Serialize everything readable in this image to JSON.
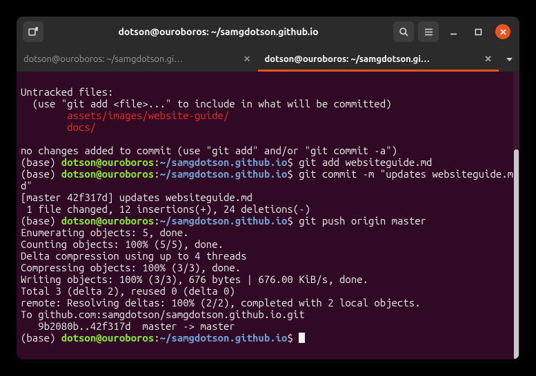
{
  "titlebar": {
    "title": "dotson@ouroboros: ~/samgdotson.github.io"
  },
  "tabs": [
    {
      "label": "dotson@ouroboros: ~/samgdotson.gi…",
      "active": false
    },
    {
      "label": "dotson@ouroboros: ~/samgdotson.gi…",
      "active": true
    }
  ],
  "scrollbar": {
    "top_pct": 27,
    "height_pct": 73
  },
  "prompt": {
    "base": "(base) ",
    "user_host": "dotson@ouroboros",
    "colon": ":",
    "cwd": "~/samgdotson.github.io",
    "dollar": "$ "
  },
  "lines": [
    {
      "t": "plain",
      "text": ""
    },
    {
      "t": "plain",
      "text": "Untracked files:"
    },
    {
      "t": "plain",
      "text": "  (use \"git add <file>...\" to include in what will be committed)"
    },
    {
      "t": "red",
      "text": "        assets/images/website-guide/"
    },
    {
      "t": "red",
      "text": "        docs/"
    },
    {
      "t": "plain",
      "text": ""
    },
    {
      "t": "plain",
      "text": "no changes added to commit (use \"git add\" and/or \"git commit -a\")"
    },
    {
      "t": "prompt",
      "cmd": "git add websiteguide.md"
    },
    {
      "t": "prompt",
      "cmd": "git commit -m \"updates websiteguide.md\""
    },
    {
      "t": "plain",
      "text": "[master 42f317d] updates websiteguide.md"
    },
    {
      "t": "plain",
      "text": " 1 file changed, 12 insertions(+), 24 deletions(-)"
    },
    {
      "t": "prompt",
      "cmd": "git push origin master"
    },
    {
      "t": "plain",
      "text": "Enumerating objects: 5, done."
    },
    {
      "t": "plain",
      "text": "Counting objects: 100% (5/5), done."
    },
    {
      "t": "plain",
      "text": "Delta compression using up to 4 threads"
    },
    {
      "t": "plain",
      "text": "Compressing objects: 100% (3/3), done."
    },
    {
      "t": "plain",
      "text": "Writing objects: 100% (3/3), 676 bytes | 676.00 KiB/s, done."
    },
    {
      "t": "plain",
      "text": "Total 3 (delta 2), reused 0 (delta 0)"
    },
    {
      "t": "plain",
      "text": "remote: Resolving deltas: 100% (2/2), completed with 2 local objects."
    },
    {
      "t": "plain",
      "text": "To github.com:samgdotson/samgdotson.github.io.git"
    },
    {
      "t": "plain",
      "text": "   9b2080b..42f317d  master -> master"
    },
    {
      "t": "prompt-cursor",
      "cmd": ""
    }
  ]
}
